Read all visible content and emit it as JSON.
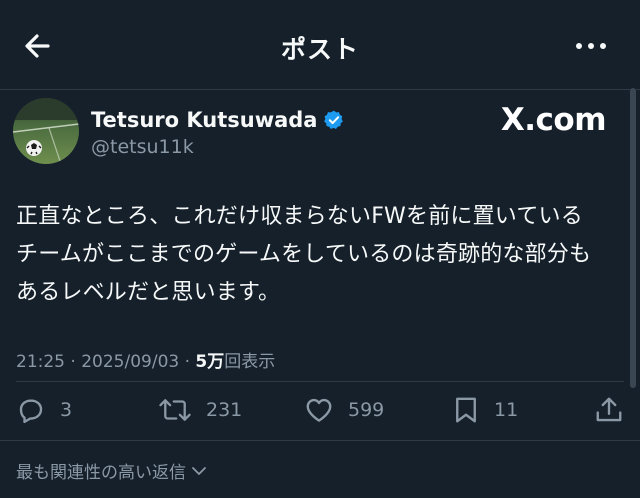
{
  "header": {
    "title": "ポスト",
    "back_icon": "arrow-left-icon",
    "more_icon": "more-horizontal-icon"
  },
  "author": {
    "display_name": "Tetsuro Kutsuwada",
    "handle": "@tetsu11k",
    "verified": true,
    "verified_color": "#1d9bf0"
  },
  "watermark": "X.com",
  "tweet": {
    "lines": [
      "正直なところ、これだけ収まらないFWを前に置いている",
      "チームがここまでのゲームをしているのは奇跡的な部分も",
      "あるレベルだと思います。"
    ]
  },
  "meta": {
    "time": "21:25",
    "sep1": " · ",
    "date": "2025/09/03",
    "sep2": " · ",
    "views_count": "5万",
    "views_label": "回表示"
  },
  "actions": {
    "replies": "3",
    "reposts": "231",
    "likes": "599",
    "bookmarks": "11"
  },
  "sort": {
    "label": "最も関連性の高い返信"
  },
  "colors": {
    "background": "#15202b",
    "text": "#f7f9f9",
    "muted": "#8b98a5",
    "divider": "#2f3a45"
  }
}
